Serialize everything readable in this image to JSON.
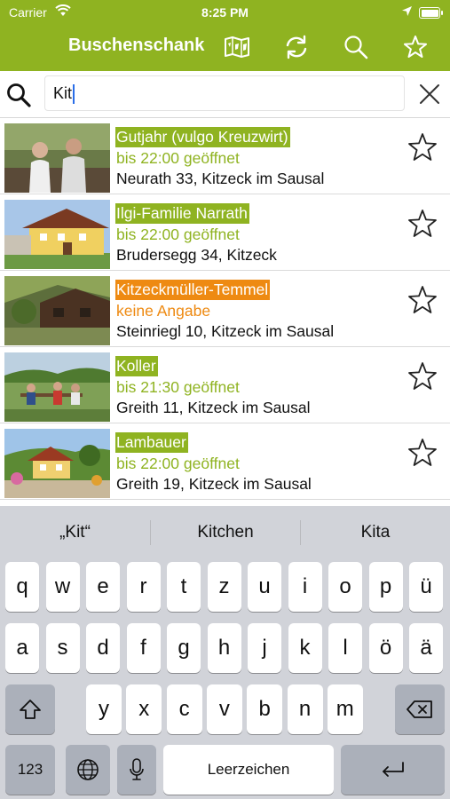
{
  "status_bar": {
    "carrier": "Carrier",
    "time": "8:25 PM"
  },
  "header": {
    "title": "Buschenschank",
    "accent_color": "#8fb321",
    "icons": [
      "map-icon",
      "refresh-icon",
      "search-icon",
      "star-icon"
    ]
  },
  "search": {
    "value": "Kit"
  },
  "results": [
    {
      "name": "Gutjahr (vulgo Kreuzwirt)",
      "hours": "bis 22:00 geöffnet",
      "address": "Neurath 33, Kitzeck im Sausal",
      "status": "open",
      "status_color": "#8fb321"
    },
    {
      "name": "Ilgi-Familie Narrath",
      "hours": "bis 22:00 geöffnet",
      "address": "Brudersegg 34, Kitzeck",
      "status": "open",
      "status_color": "#8fb321"
    },
    {
      "name": "Kitzeckmüller-Temmel",
      "hours": "keine Angabe",
      "address": "Steinriegl 10, Kitzeck im Sausal",
      "status": "unknown",
      "status_color": "#ee8a12"
    },
    {
      "name": "Koller",
      "hours": "bis 21:30 geöffnet",
      "address": "Greith 11, Kitzeck im Sausal",
      "status": "open",
      "status_color": "#8fb321"
    },
    {
      "name": "Lambauer",
      "hours": "bis 22:00 geöffnet",
      "address": "Greith 19, Kitzeck im Sausal",
      "status": "open",
      "status_color": "#8fb321"
    }
  ],
  "keyboard": {
    "suggestions": [
      "„Kit“",
      "Kitchen",
      "Kita"
    ],
    "row1": [
      "q",
      "w",
      "e",
      "r",
      "t",
      "z",
      "u",
      "i",
      "o",
      "p",
      "ü"
    ],
    "row2": [
      "a",
      "s",
      "d",
      "f",
      "g",
      "h",
      "j",
      "k",
      "l",
      "ö",
      "ä"
    ],
    "row3": [
      "y",
      "x",
      "c",
      "v",
      "b",
      "n",
      "m"
    ],
    "numbers_label": "123",
    "space_label": "Leerzeichen"
  }
}
